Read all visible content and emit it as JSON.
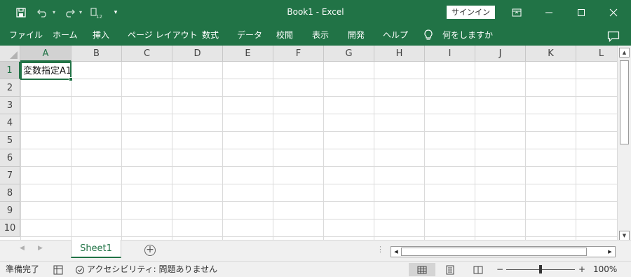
{
  "window": {
    "title": "Book1  -  Excel",
    "signin_label": "サインイン"
  },
  "quick_access": {
    "icons": [
      "save-icon",
      "undo-icon",
      "redo-icon",
      "sort-icon",
      "customize-icon"
    ]
  },
  "ribbon": {
    "tabs": [
      "ファイル",
      "ホーム",
      "挿入",
      "ページ レイアウト",
      "数式",
      "データ",
      "校閲",
      "表示",
      "開発",
      "ヘルプ"
    ],
    "tell_me": "何をしますか"
  },
  "grid": {
    "columns": [
      "A",
      "B",
      "C",
      "D",
      "E",
      "F",
      "G",
      "H",
      "I",
      "J",
      "K",
      "L"
    ],
    "rows": [
      "1",
      "2",
      "3",
      "4",
      "5",
      "6",
      "7",
      "8",
      "9",
      "10"
    ],
    "selected_cell": "A1",
    "cell_a1": "変数指定A1"
  },
  "sheets": {
    "tabs": [
      "Sheet1"
    ],
    "active": "Sheet1"
  },
  "status": {
    "ready": "準備完了",
    "accessibility": "アクセシビリティ: 問題ありません",
    "zoom_minus": "−",
    "zoom_plus": "+",
    "zoom": "100%"
  },
  "colors": {
    "accent": "#217346",
    "header_bg": "#e6e6e6",
    "gridline": "#dadada"
  }
}
